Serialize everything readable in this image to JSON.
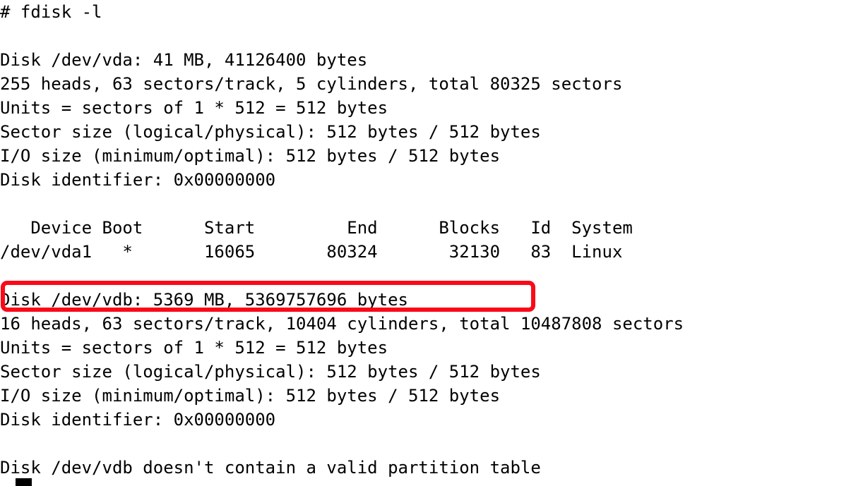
{
  "terminal": {
    "prompt_line": "# fdisk -l",
    "lines": [
      "# fdisk -l",
      "",
      "Disk /dev/vda: 41 MB, 41126400 bytes",
      "255 heads, 63 sectors/track, 5 cylinders, total 80325 sectors",
      "Units = sectors of 1 * 512 = 512 bytes",
      "Sector size (logical/physical): 512 bytes / 512 bytes",
      "I/O size (minimum/optimal): 512 bytes / 512 bytes",
      "Disk identifier: 0x00000000",
      "",
      "   Device Boot      Start         End      Blocks   Id  System",
      "/dev/vda1   *       16065       80324       32130   83  Linux",
      "",
      "Disk /dev/vdb: 5369 MB, 5369757696 bytes",
      "16 heads, 63 sectors/track, 10404 cylinders, total 10487808 sectors",
      "Units = sectors of 1 * 512 = 512 bytes",
      "Sector size (logical/physical): 512 bytes / 512 bytes",
      "I/O size (minimum/optimal): 512 bytes / 512 bytes",
      "Disk identifier: 0x00000000",
      "",
      "Disk /dev/vdb doesn't contain a valid partition table"
    ],
    "command": "fdisk -l",
    "disks": [
      {
        "name": "/dev/vda",
        "size_human": "41 MB",
        "size_bytes": "41126400",
        "heads": "255",
        "sectors_per_track": "63",
        "cylinders": "5",
        "total_sectors": "80325",
        "units": "sectors of 1 * 512 = 512 bytes",
        "sector_size": "512 bytes / 512 bytes",
        "io_size": "512 bytes / 512 bytes",
        "identifier": "0x00000000",
        "partition_table": {
          "headers": [
            "Device",
            "Boot",
            "Start",
            "End",
            "Blocks",
            "Id",
            "System"
          ],
          "rows": [
            {
              "device": "/dev/vda1",
              "boot": "*",
              "start": "16065",
              "end": "80324",
              "blocks": "32130",
              "id": "83",
              "system": "Linux"
            }
          ]
        }
      },
      {
        "name": "/dev/vdb",
        "size_human": "5369 MB",
        "size_bytes": "5369757696",
        "heads": "16",
        "sectors_per_track": "63",
        "cylinders": "10404",
        "total_sectors": "10487808",
        "units": "sectors of 1 * 512 = 512 bytes",
        "sector_size": "512 bytes / 512 bytes",
        "io_size": "512 bytes / 512 bytes",
        "identifier": "0x00000000",
        "warning": "Disk /dev/vdb doesn't contain a valid partition table"
      }
    ],
    "annotation": {
      "type": "rectangle-highlight",
      "color": "#fa0a18",
      "target_line": "Disk /dev/vdb: 5369 MB, 5369757696 bytes"
    },
    "colors": {
      "background": "#ffffff",
      "foreground": "#000000",
      "highlight": "#fa0a18"
    }
  }
}
